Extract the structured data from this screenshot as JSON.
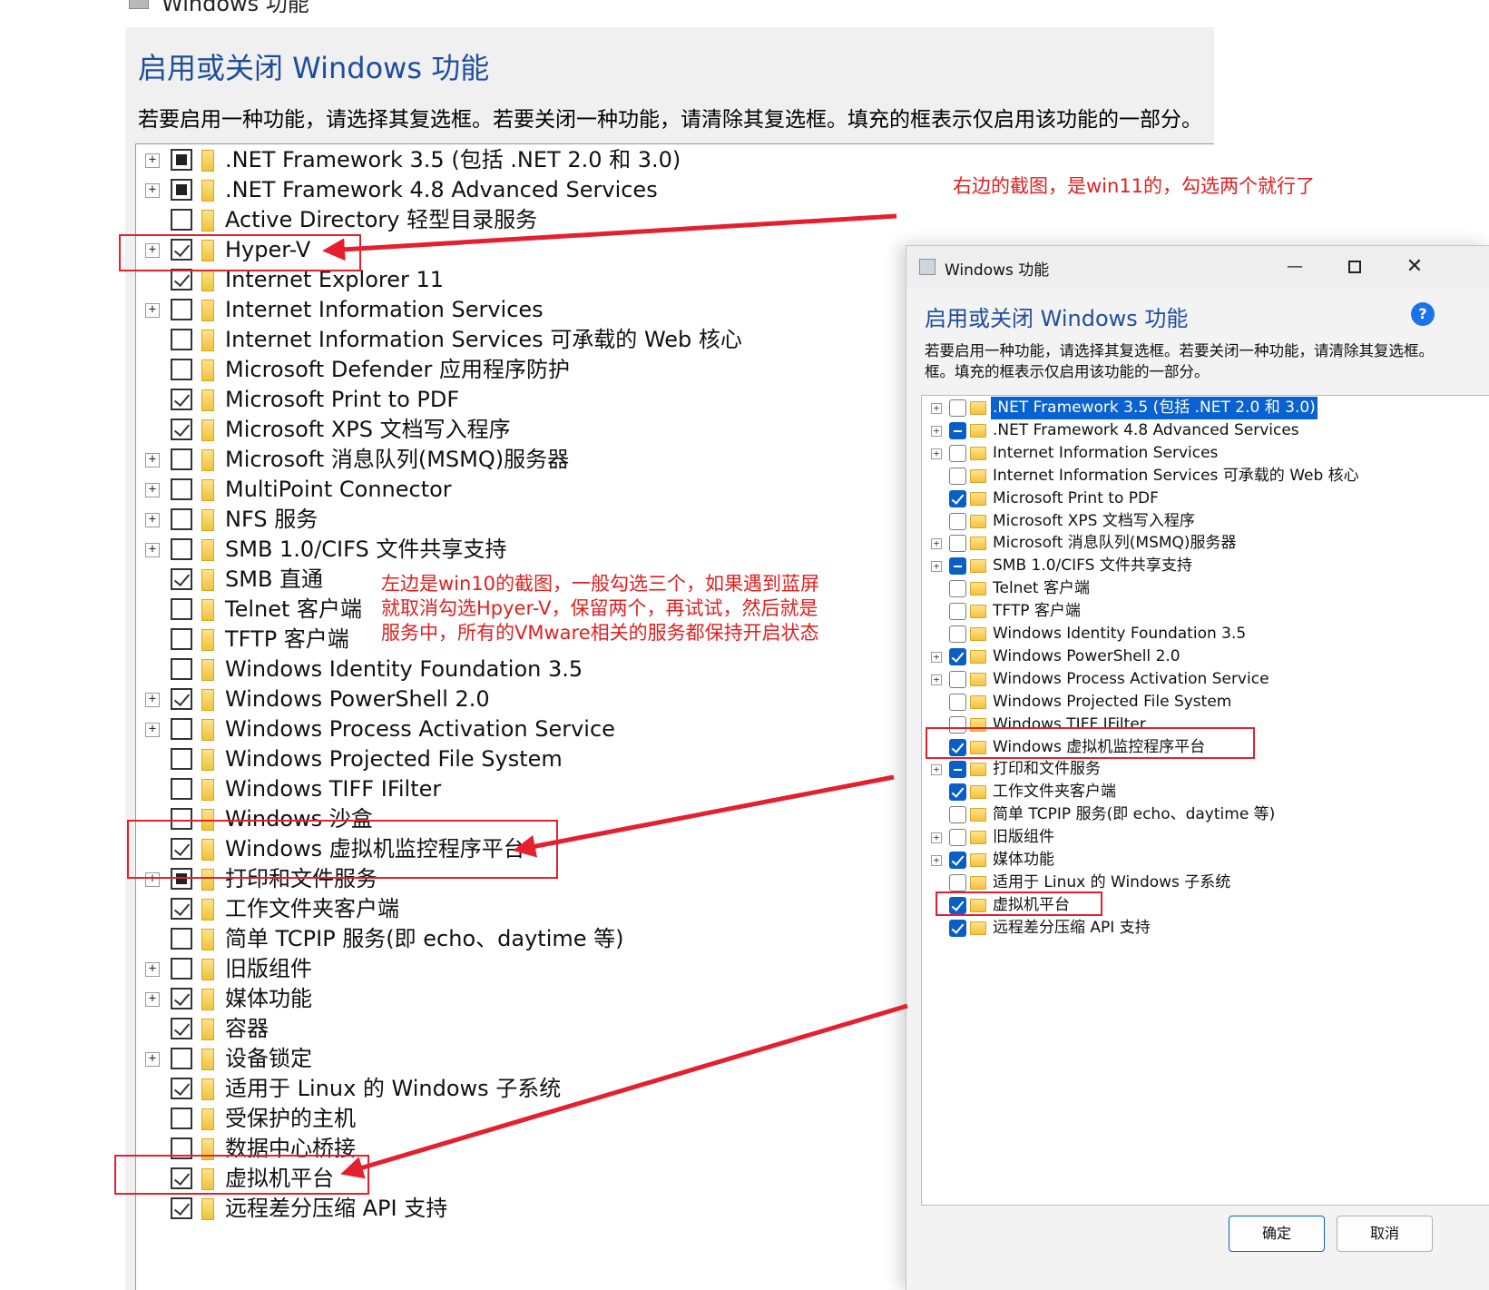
{
  "win10": {
    "window_title": "Windows 功能",
    "title": "启用或关闭 Windows 功能",
    "description": "若要启用一种功能，请选择其复选框。若要关闭一种功能，请清除其复选框。填充的框表示仅启用该功能的一部分。",
    "features": [
      {
        "label": ".NET Framework 3.5 (包括 .NET 2.0 和 3.0)",
        "state": "partial",
        "expandable": true
      },
      {
        "label": ".NET Framework 4.8 Advanced Services",
        "state": "partial",
        "expandable": true
      },
      {
        "label": "Active Directory 轻型目录服务",
        "state": "unchecked",
        "expandable": false
      },
      {
        "label": "Hyper-V",
        "state": "checked",
        "expandable": true
      },
      {
        "label": "Internet Explorer 11",
        "state": "checked",
        "expandable": false
      },
      {
        "label": "Internet Information Services",
        "state": "unchecked",
        "expandable": true
      },
      {
        "label": "Internet Information Services 可承载的 Web 核心",
        "state": "unchecked",
        "expandable": false
      },
      {
        "label": "Microsoft Defender 应用程序防护",
        "state": "unchecked",
        "expandable": false
      },
      {
        "label": "Microsoft Print to PDF",
        "state": "checked",
        "expandable": false
      },
      {
        "label": "Microsoft XPS 文档写入程序",
        "state": "checked",
        "expandable": false
      },
      {
        "label": "Microsoft 消息队列(MSMQ)服务器",
        "state": "unchecked",
        "expandable": true
      },
      {
        "label": "MultiPoint Connector",
        "state": "unchecked",
        "expandable": true
      },
      {
        "label": "NFS 服务",
        "state": "unchecked",
        "expandable": true
      },
      {
        "label": "SMB 1.0/CIFS 文件共享支持",
        "state": "unchecked",
        "expandable": true
      },
      {
        "label": "SMB 直通",
        "state": "checked",
        "expandable": false
      },
      {
        "label": "Telnet 客户端",
        "state": "unchecked",
        "expandable": false
      },
      {
        "label": "TFTP 客户端",
        "state": "unchecked",
        "expandable": false
      },
      {
        "label": "Windows Identity Foundation 3.5",
        "state": "unchecked",
        "expandable": false
      },
      {
        "label": "Windows PowerShell 2.0",
        "state": "checked",
        "expandable": true
      },
      {
        "label": "Windows Process Activation Service",
        "state": "unchecked",
        "expandable": true
      },
      {
        "label": "Windows Projected File System",
        "state": "unchecked",
        "expandable": false
      },
      {
        "label": "Windows TIFF IFilter",
        "state": "unchecked",
        "expandable": false
      },
      {
        "label": "Windows 沙盒",
        "state": "unchecked",
        "expandable": false
      },
      {
        "label": "Windows 虚拟机监控程序平台",
        "state": "checked",
        "expandable": false
      },
      {
        "label": "打印和文件服务",
        "state": "partial",
        "expandable": true
      },
      {
        "label": "工作文件夹客户端",
        "state": "checked",
        "expandable": false
      },
      {
        "label": "简单 TCPIP 服务(即 echo、daytime 等)",
        "state": "unchecked",
        "expandable": false
      },
      {
        "label": "旧版组件",
        "state": "unchecked",
        "expandable": true
      },
      {
        "label": "媒体功能",
        "state": "checked",
        "expandable": true
      },
      {
        "label": "容器",
        "state": "checked",
        "expandable": false
      },
      {
        "label": "设备锁定",
        "state": "unchecked",
        "expandable": true
      },
      {
        "label": "适用于 Linux 的 Windows 子系统",
        "state": "checked",
        "expandable": false
      },
      {
        "label": "受保护的主机",
        "state": "unchecked",
        "expandable": false
      },
      {
        "label": "数据中心桥接",
        "state": "unchecked",
        "expandable": false
      },
      {
        "label": "虚拟机平台",
        "state": "checked",
        "expandable": false
      },
      {
        "label": "远程差分压缩 API 支持",
        "state": "checked",
        "expandable": false
      }
    ]
  },
  "win11": {
    "window_title": "Windows 功能",
    "controls": {
      "minimize": "—",
      "close": "✕"
    },
    "heading": "启用或关闭 Windows 功能",
    "help": "?",
    "description_lines": [
      "若要启用一种功能，请选择其复选框。若要关闭一种功能，请清除其复选框。",
      "框。填充的框表示仅启用该功能的一部分。"
    ],
    "features": [
      {
        "label": ".NET Framework 3.5 (包括 .NET 2.0 和 3.0)",
        "state": "unchecked",
        "expandable": true,
        "selected": true
      },
      {
        "label": ".NET Framework 4.8 Advanced Services",
        "state": "partial",
        "expandable": true
      },
      {
        "label": "Internet Information Services",
        "state": "unchecked",
        "expandable": true
      },
      {
        "label": "Internet Information Services 可承载的 Web 核心",
        "state": "unchecked",
        "expandable": false
      },
      {
        "label": "Microsoft Print to PDF",
        "state": "checked",
        "expandable": false
      },
      {
        "label": "Microsoft XPS 文档写入程序",
        "state": "unchecked",
        "expandable": false
      },
      {
        "label": "Microsoft 消息队列(MSMQ)服务器",
        "state": "unchecked",
        "expandable": true
      },
      {
        "label": "SMB 1.0/CIFS 文件共享支持",
        "state": "partial",
        "expandable": true
      },
      {
        "label": "Telnet 客户端",
        "state": "unchecked",
        "expandable": false
      },
      {
        "label": "TFTP 客户端",
        "state": "unchecked",
        "expandable": false
      },
      {
        "label": "Windows Identity Foundation 3.5",
        "state": "unchecked",
        "expandable": false
      },
      {
        "label": "Windows PowerShell 2.0",
        "state": "checked",
        "expandable": true
      },
      {
        "label": "Windows Process Activation Service",
        "state": "unchecked",
        "expandable": true
      },
      {
        "label": "Windows Projected File System",
        "state": "unchecked",
        "expandable": false
      },
      {
        "label": "Windows TIFF IFilter",
        "state": "unchecked",
        "expandable": false
      },
      {
        "label": "Windows 虚拟机监控程序平台",
        "state": "checked",
        "expandable": false
      },
      {
        "label": "打印和文件服务",
        "state": "partial",
        "expandable": true
      },
      {
        "label": "工作文件夹客户端",
        "state": "checked",
        "expandable": false
      },
      {
        "label": "简单 TCPIP 服务(即 echo、daytime 等)",
        "state": "unchecked",
        "expandable": false
      },
      {
        "label": "旧版组件",
        "state": "unchecked",
        "expandable": true
      },
      {
        "label": "媒体功能",
        "state": "checked",
        "expandable": true
      },
      {
        "label": "适用于 Linux 的 Windows 子系统",
        "state": "unchecked",
        "expandable": false
      },
      {
        "label": "虚拟机平台",
        "state": "checked",
        "expandable": false
      },
      {
        "label": "远程差分压缩 API 支持",
        "state": "checked",
        "expandable": false
      }
    ],
    "buttons": {
      "ok": "确定",
      "cancel": "取消"
    }
  },
  "annotations": {
    "right_note": "右边的截图，是win11的，勾选两个就行了",
    "left_note_lines": [
      "左边是win10的截图，一般勾选三个，如果遇到蓝屏",
      "就取消勾选Hpyer-V，保留两个，再试试，然后就是",
      "服务中，所有的VMware相关的服务都保持开启状态"
    ],
    "color": "#e02020"
  },
  "colors": {
    "title_blue": "#1f4e9c",
    "win11_accent": "#0a5fc4",
    "annotation_red": "#e4202e"
  }
}
